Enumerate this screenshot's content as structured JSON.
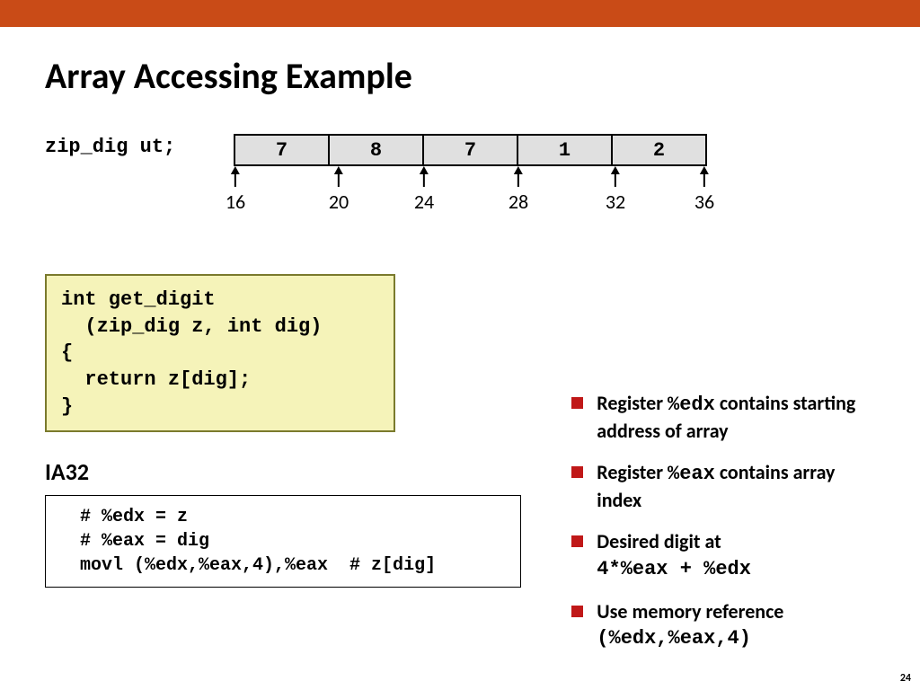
{
  "title": "Array Accessing Example",
  "array": {
    "label": "zip_dig  ut;",
    "cells": [
      "7",
      "8",
      "7",
      "1",
      "2"
    ],
    "addresses": [
      "16",
      "20",
      "24",
      "28",
      "32",
      "36"
    ]
  },
  "code_c": "int get_digit\n  (zip_dig z, int dig)\n{\n  return z[dig];\n}",
  "ia32_label": "IA32",
  "code_asm": "  # %edx = z\n  # %eax = dig\n  movl (%edx,%eax,4),%eax  # z[dig]",
  "bullets": {
    "b1a": "Register ",
    "b1b": "%edx",
    "b1c": " contains starting address of array",
    "b2a": "Register ",
    "b2b": "%eax",
    "b2c": " contains array index",
    "b3a": "Desired digit at ",
    "b3b": "4*%eax + %edx",
    "b4a": "Use memory reference ",
    "b4b": "(%edx,%eax,4)"
  },
  "page_number": "24"
}
